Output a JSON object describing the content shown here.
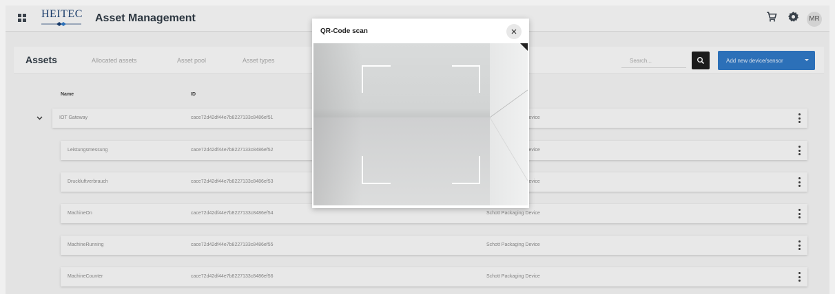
{
  "header": {
    "brand": "HEITEC",
    "title": "Asset Management",
    "avatar": "MR",
    "icons": [
      "apps-icon",
      "cart-icon",
      "gear-icon"
    ]
  },
  "tabs": {
    "title": "Assets",
    "items": [
      "Allocated assets",
      "Asset pool",
      "Asset types"
    ]
  },
  "search": {
    "placeholder": "Search..."
  },
  "add_button": {
    "label": "Add new device/sensor"
  },
  "table": {
    "columns": [
      "Name",
      "ID"
    ],
    "rows": [
      {
        "name": "IOT Gateway",
        "id": "cace72d42df44e7b8227133c8486ef51",
        "type": "Schott Packaging Device"
      },
      {
        "name": "Leistungsmessung",
        "id": "cace72d42df44e7b8227133c8486ef52",
        "type": "Schott Packaging Device"
      },
      {
        "name": "Druckluftverbrauch",
        "id": "cace72d42df44e7b8227133c8486ef53",
        "type": "Schott Packaging Device"
      },
      {
        "name": "MachineOn",
        "id": "cace72d42df44e7b8227133c8486ef54",
        "type": "Schott Packaging Device"
      },
      {
        "name": "MachineRunning",
        "id": "cace72d42df44e7b8227133c8486ef55",
        "type": "Schott Packaging Device"
      },
      {
        "name": "MachineCounter",
        "id": "cace72d42df44e7b8227133c8486ef56",
        "type": "Schott Packaging Device"
      }
    ],
    "visible_type_fragments": [
      "g Device",
      "g Device",
      "g Device",
      "Schott Packaging Device",
      "Schott Packaging Device",
      "Schott Packaging Device"
    ]
  },
  "modal": {
    "title": "QR-Code scan",
    "close_icon": "close-icon"
  },
  "colors": {
    "brand": "#173c6e",
    "primary_button": "#2f77c4",
    "search_button": "#1d1d1d"
  }
}
